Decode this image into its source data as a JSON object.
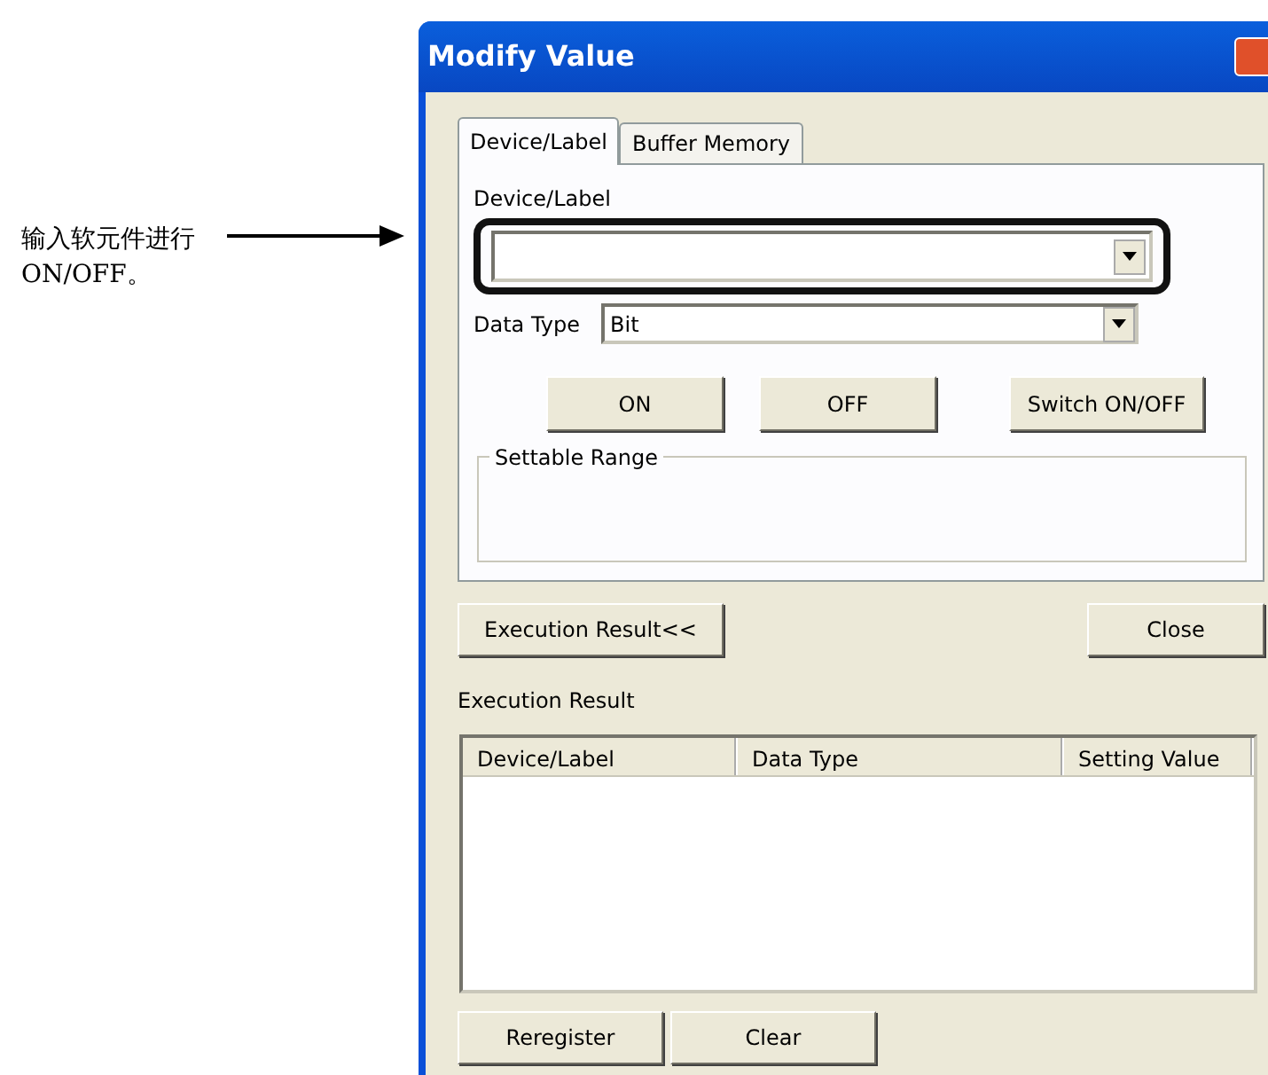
{
  "annotation": {
    "text": "输入软元件进行ON/OFF。"
  },
  "window": {
    "title": "Modify Value"
  },
  "tabs": [
    {
      "label": "Device/Label",
      "selected": true
    },
    {
      "label": "Buffer Memory",
      "selected": false
    }
  ],
  "device_field": {
    "label": "Device/Label"
  },
  "data_type": {
    "label": "Data Type",
    "value": "Bit"
  },
  "action_buttons": [
    {
      "label": "ON"
    },
    {
      "label": "OFF"
    },
    {
      "label": "Switch ON/OFF"
    }
  ],
  "settable_range": {
    "legend": "Settable Range"
  },
  "toggle_button": {
    "label": "Execution Result<<"
  },
  "close_button": {
    "label": "Close"
  },
  "execution_result": {
    "label": "Execution Result",
    "columns": [
      "Device/Label",
      "Data Type",
      "Setting Value"
    ]
  },
  "bottom_buttons": [
    {
      "label": "Reregister"
    },
    {
      "label": "Clear"
    }
  ]
}
